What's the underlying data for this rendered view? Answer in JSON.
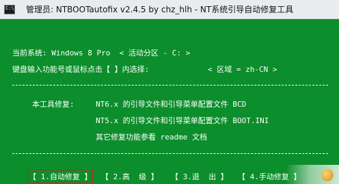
{
  "window": {
    "title": "管理员:  NTBOOTautofix v2.4.5 by chz_hlh - NT系统引导自动修复工具",
    "icon": "cmd-console-icon",
    "icon_text": "C:\\"
  },
  "console": {
    "system_line": "当前系统: Windows 8 Pro  < 活动分区 - C: >",
    "prompt_line": "键盘输入功能号或鼠标点击【 】内选择:",
    "region_label": "< 区域 = zh-CN >",
    "separator": "------------------------------------------------------------------------------",
    "repair_heading": "本工具修复:",
    "repair_items": [
      "NT6.x 的引导文件和引导菜单配置文件 BCD",
      "NT5.x 的引导文件和引导菜单配置文件 BOOT.INI",
      "其它修复功能参看 readme 文档"
    ]
  },
  "menu": {
    "items": [
      "【 1.自动修复 】",
      "【 2.高  级 】",
      "【 3.退  出 】",
      "【 4.手动修复 】"
    ],
    "selected_index": 0
  },
  "colors": {
    "console_background": "#0b8e2b",
    "console_text": "#ffffff",
    "selection_border": "#d21f1f",
    "titlebar": "#e9ecef"
  }
}
